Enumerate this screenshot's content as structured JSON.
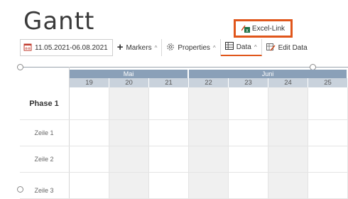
{
  "page": {
    "title": "Gantt"
  },
  "excel_link": {
    "label": "Excel-Link"
  },
  "toolbar": {
    "date_range": "11.05.2021-06.08.2021",
    "markers": "Markers",
    "properties": "Properties",
    "data": "Data",
    "edit_data": "Edit Data"
  },
  "timeline": {
    "months": [
      "Mai",
      "Juni"
    ],
    "days": [
      "19",
      "20",
      "21",
      "22",
      "23",
      "24",
      "25"
    ]
  },
  "rows": [
    {
      "label": "Phase 1",
      "type": "phase"
    },
    {
      "label": "Zeile 1",
      "type": "row"
    },
    {
      "label": "Zeile 2",
      "type": "row"
    },
    {
      "label": "Zeile 3",
      "type": "row"
    }
  ],
  "colors": {
    "accent": "#e0561b",
    "month_header": "#8aa0b8",
    "day_header": "#c9d2dc",
    "weekend": "#f0f0f0"
  }
}
